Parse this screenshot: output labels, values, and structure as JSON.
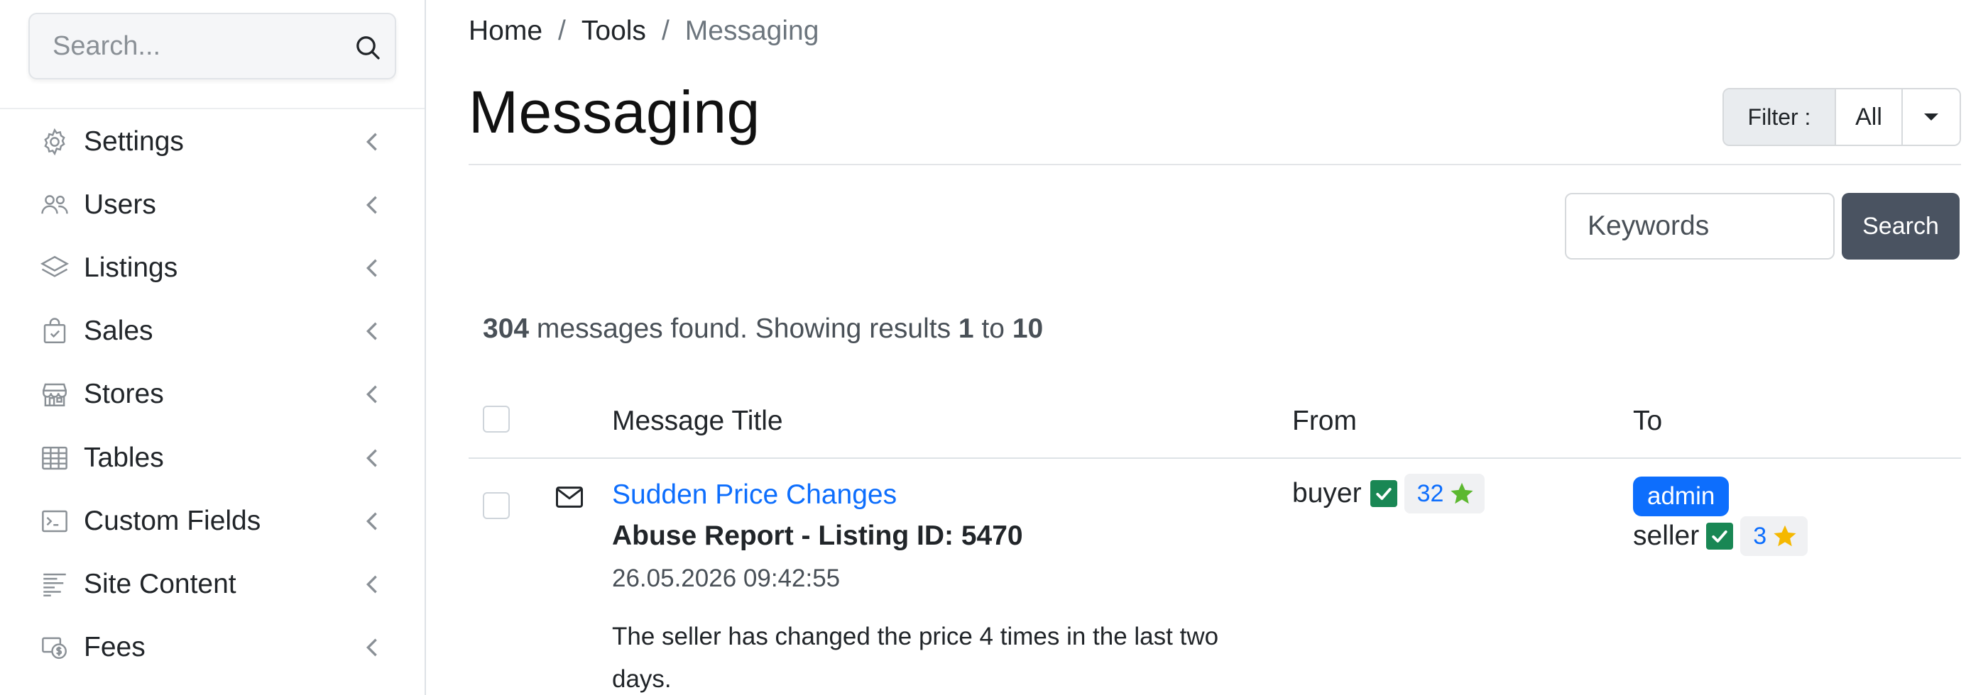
{
  "sidebar": {
    "search": {
      "placeholder": "Search..."
    },
    "items": [
      {
        "label": "Settings",
        "icon": "gear-icon"
      },
      {
        "label": "Users",
        "icon": "users-icon"
      },
      {
        "label": "Listings",
        "icon": "layers-icon"
      },
      {
        "label": "Sales",
        "icon": "shopping-bag-icon"
      },
      {
        "label": "Stores",
        "icon": "store-icon"
      },
      {
        "label": "Tables",
        "icon": "table-icon"
      },
      {
        "label": "Custom Fields",
        "icon": "terminal-icon"
      },
      {
        "label": "Site Content",
        "icon": "text-lines-icon"
      },
      {
        "label": "Fees",
        "icon": "fees-icon"
      }
    ]
  },
  "breadcrumb": {
    "home": "Home",
    "tools": "Tools",
    "current": "Messaging",
    "separator": "/"
  },
  "page": {
    "title": "Messaging"
  },
  "filter": {
    "label": "Filter :",
    "value": "All"
  },
  "search": {
    "placeholder": "Keywords",
    "button_label": "Search"
  },
  "results": {
    "total": "304",
    "text_found": "messages found. Showing results",
    "from": "1",
    "to_word": "to",
    "to": "10"
  },
  "table": {
    "columns": {
      "title": "Message Title",
      "from": "From",
      "to": "To"
    },
    "rows": [
      {
        "title_link": "Sudden Price Changes",
        "subject": "Abuse Report - Listing ID: 5470",
        "date": "26.05.2026 09:42:55",
        "body": "The seller has changed the price 4 times in the last two days.",
        "from": {
          "user": "buyer",
          "rating": "32",
          "star_color": "#5cb82f"
        },
        "to": {
          "admin_badge": "admin",
          "user": "seller",
          "rating": "3",
          "star_color": "#f5b800"
        }
      }
    ]
  },
  "colors": {
    "link": "#0d6efd",
    "verified": "#198754",
    "search_button": "#4a5361"
  }
}
